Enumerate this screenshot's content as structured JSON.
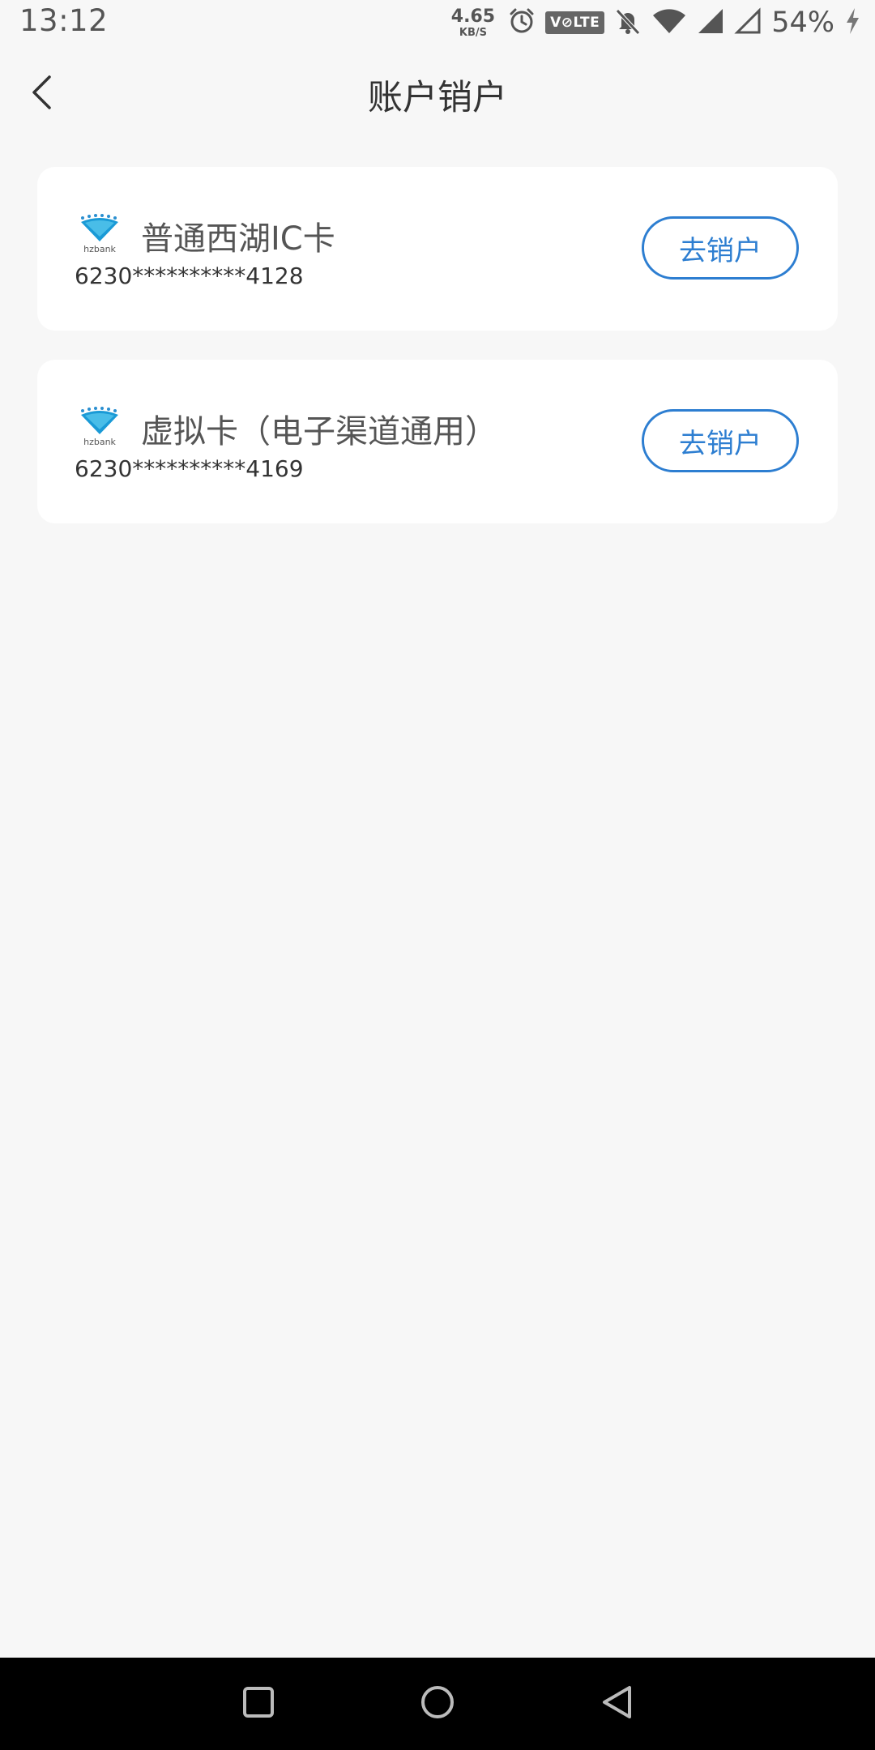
{
  "status_bar": {
    "time": "13:12",
    "net_speed_value": "4.65",
    "net_speed_unit": "KB/S",
    "volte_label": "V⊘LTE",
    "battery": "54%"
  },
  "header": {
    "title": "账户销户"
  },
  "accounts": [
    {
      "name": "普通西湖IC卡",
      "number": "6230**********4128",
      "button_label": "去销户",
      "logo_text": "hzbank"
    },
    {
      "name": "虚拟卡（电子渠道通用）",
      "number": "6230**********4169",
      "button_label": "去销户",
      "logo_text": "hzbank"
    }
  ],
  "icons": {
    "back": "chevron-left-icon",
    "alarm": "alarm-icon",
    "mute": "bell-off-icon",
    "wifi": "wifi-icon",
    "signal": "signal-icon",
    "charging": "lightning-icon",
    "nav_recent": "square-icon",
    "nav_home": "circle-icon",
    "nav_back": "triangle-left-icon"
  },
  "colors": {
    "accent": "#2d7ed1",
    "background": "#f7f7f7",
    "card": "#ffffff",
    "nav_bar": "#000000"
  }
}
